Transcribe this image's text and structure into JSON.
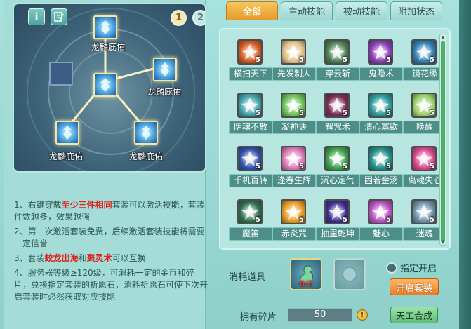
{
  "header": {
    "page_tabs": [
      "1",
      "2"
    ]
  },
  "constellation": {
    "slot_label": "龙麟庇佑"
  },
  "rules": {
    "r1_a": "1、右键穿戴",
    "r1_hl": "至少三件相同",
    "r1_b": "套装可以激活技能，套装件数越多，效果越强",
    "r2": "2、第一次激活套装免费，后续激活套装技能将需要一定信誉",
    "r3_a": "3、套装",
    "r3_hl1": "蛟龙出海",
    "r3_mid": "和",
    "r3_hl2": "聚灵术",
    "r3_b": "可以互换",
    "r4": "4、服务器等级≥120级，可消耗一定的金币和碎片，兑换指定套装的祈愿石，消耗祈愿石可使下次开启套装时必然获取对应技能"
  },
  "tabs": [
    "全部",
    "主动技能",
    "被动技能",
    "附加状态"
  ],
  "skills": [
    {
      "name": "横扫天下",
      "level": "5",
      "color": "#d2581e"
    },
    {
      "name": "先发制人",
      "level": "5",
      "color": "#e0c28a"
    },
    {
      "name": "穿云斩",
      "level": "5",
      "color": "#4c7f54"
    },
    {
      "name": "鬼隐术",
      "level": "5",
      "color": "#8a3bb8"
    },
    {
      "name": "镜花缘",
      "level": "5",
      "color": "#2e7fb5"
    },
    {
      "name": "阴魂不散",
      "level": "5",
      "color": "#3da2a8"
    },
    {
      "name": "凝神诀",
      "level": "5",
      "color": "#6cc35b"
    },
    {
      "name": "解咒术",
      "level": "5",
      "color": "#7a2a55"
    },
    {
      "name": "清心寡欲",
      "level": "5",
      "color": "#2a9a9a"
    },
    {
      "name": "唤醒",
      "level": "5",
      "color": "#9bd16a"
    },
    {
      "name": "千机百转",
      "level": "5",
      "color": "#2f4ea8"
    },
    {
      "name": "逢春生辉",
      "level": "5",
      "color": "#e07ab8"
    },
    {
      "name": "沉心定气",
      "level": "5",
      "color": "#3ba24a"
    },
    {
      "name": "固若金汤",
      "level": "5",
      "color": "#1f8f8a"
    },
    {
      "name": "离魂失心",
      "level": "5",
      "color": "#d9468a"
    },
    {
      "name": "魔笛",
      "level": "5",
      "color": "#2c6e4a"
    },
    {
      "name": "赤炎咒",
      "level": "5",
      "color": "#e89a20"
    },
    {
      "name": "抽里乾坤",
      "level": "5",
      "color": "#3a2a90"
    },
    {
      "name": "魅心",
      "level": "5",
      "color": "#b84fbf"
    },
    {
      "name": "迷魂",
      "level": "5",
      "color": "#6a8fa8"
    }
  ],
  "bottom": {
    "consume_label": "消耗道具",
    "consume_count": "0/2",
    "specified_label": "指定开启",
    "open_button": "开启套装",
    "fragments_label": "拥有碎片",
    "fragments_value": "50",
    "craft_button": "天工合成"
  }
}
